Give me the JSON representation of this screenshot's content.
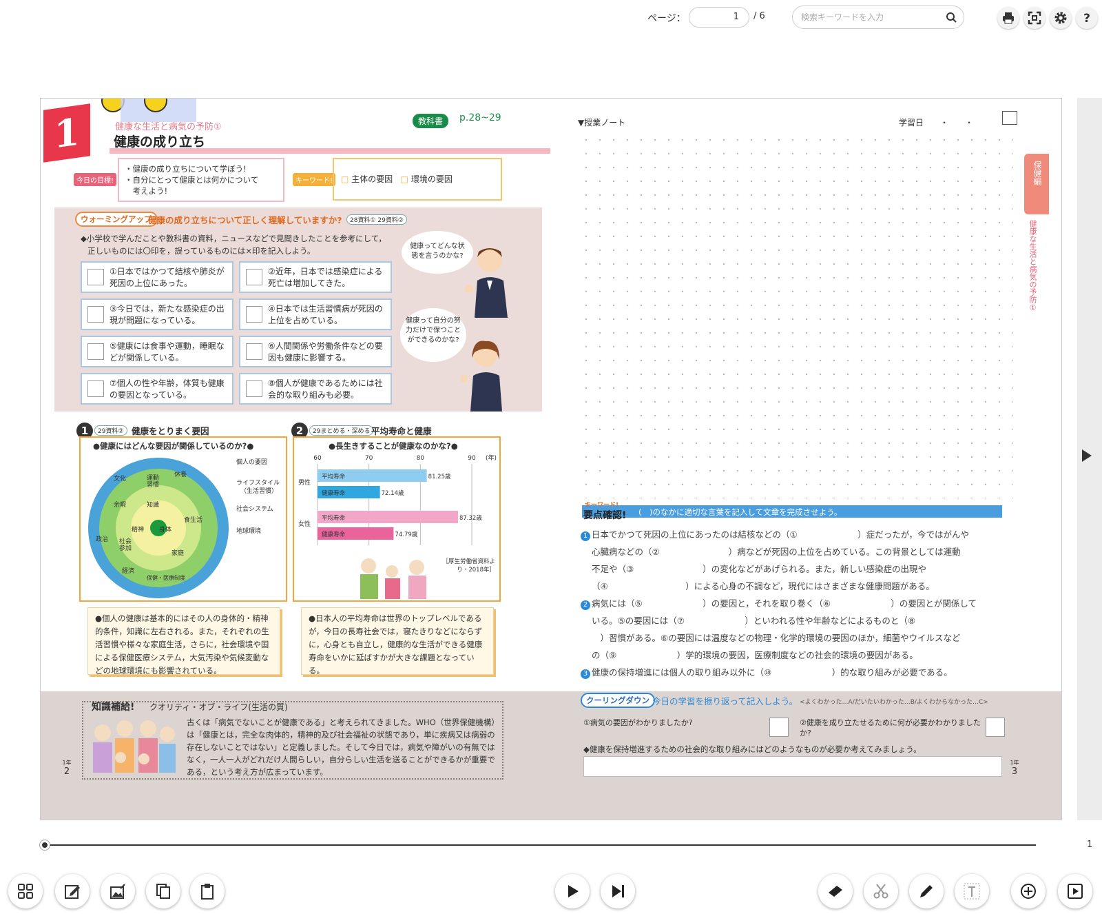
{
  "toolbar": {
    "page_label": "ページ：",
    "page_value": "1",
    "page_total": "/ 6",
    "search_placeholder": "検索キーワードを入力"
  },
  "left_page": {
    "chapter_number": "1",
    "subtitle": "健康な生活と病気の予防①",
    "title": "健康の成り立ち",
    "textbook_badge": "教科書",
    "textbook_pages": "p.28~29",
    "goal_label": "今日の目標!",
    "goals": [
      "・健康の成り立ちについて学ぼう!",
      "・自分にとって健康とは何かについて",
      "　考えよう!"
    ],
    "keyword_label": "キーワード!",
    "keywords": [
      "主体の要因",
      "環境の要因"
    ],
    "warmup": {
      "badge": "ウォーミングアップ",
      "question": "健康の成り立ちについて正しく理解していますか?",
      "ref": "28資料① 29資料②",
      "instruction1": "◆小学校で学んだことや教科書の資料，ニュースなどで見聞きしたことを参考にして，",
      "instruction2": "正しいものには〇印を，誤っているものには×印を記入しよう。",
      "items": [
        "①日本ではかつて結核や肺炎が死因の上位にあった。",
        "②近年，日本では感染症による死亡は増加してきた。",
        "③今日では，新たな感染症の出現が問題になっている。",
        "④日本では生活習慣病が死因の上位を占めている。",
        "⑤健康には食事や運動，睡眠などが関係している。",
        "⑥人間関係や労働条件などの要因も健康に影響する。",
        "⑦個人の性や年齢，体質も健康の要因となっている。",
        "⑧個人が健康であるためには社会的な取り組みも必要。"
      ],
      "bubble1": "健康ってどんな状態を言うのかな?",
      "bubble2": "健康って自分の努力だけで保つことができるのかな?"
    },
    "section1": {
      "number": "1",
      "ref": "29資料②",
      "title": "健康をとりまく要因",
      "question": "●健康にはどんな要因が関係しているのか?●",
      "legend": [
        "個人の要因",
        "ライフスタイル",
        "（生活習慣）",
        "社会システム",
        "地球環境"
      ],
      "center_labels": [
        "知識",
        "精神",
        "身体"
      ],
      "inner_labels": [
        "運動習慣",
        "食生活",
        "休養"
      ],
      "middle_labels": [
        "文化",
        "教育",
        "余暇",
        "社会参加",
        "家庭"
      ],
      "outer_labels": [
        "政治",
        "経済",
        "保健・医療制度"
      ],
      "explanation": "●個人の健康は基本的にはその人の身体的・精神的条件，知識に左右される。また，それぞれの生活習慣や様々な家庭生活，さらに，社会環境や国による保健医療システム，大気汚染や気候変動などの地球環境にも影響されている。"
    },
    "section2": {
      "number": "2",
      "ref": "29まとめる・深める",
      "title": "平均寿命と健康",
      "question": "●長生きすることが健康なのかな?●",
      "explanation": "●日本人の平均寿命は世界のトップレベルであるが，今日の長寿社会では，寝たきりなどにならずに，心身とも自立し，健康的な生活ができる健康寿命をいかに延ばすかが大きな課題となっている。",
      "source": "［厚生労働省資料より・2018年］"
    },
    "knowledge": {
      "title": "知識補給!",
      "subtitle": "クオリティ・オブ・ライフ(生活の質)",
      "text": "古くは「病気でないことが健康である」と考えられてきました。WHO（世界保健機構）は「健康とは，完全な肉体的，精神的及び社会福祉の状態であり，単に疾病又は病弱の存在しないことではない」と定義しました。そして今日では，病気や障がいの有無ではなく，一人一人がどれだけ人間らしい，自分らしい生活を送ることができるかが重要である，という考え方が広まっています。"
    },
    "page_grade": "1年",
    "page_number": "2"
  },
  "chart_data": {
    "type": "bar",
    "x_ticks": [
      "60",
      "70",
      "80",
      "90"
    ],
    "x_unit": "(年)",
    "xlim": [
      60,
      90
    ],
    "groups": [
      {
        "name": "男性",
        "bars": [
          {
            "label": "平均寿命",
            "value": 81.25,
            "text": "81.25歳"
          },
          {
            "label": "健康寿命",
            "value": 72.14,
            "text": "72.14歳"
          }
        ]
      },
      {
        "name": "女性",
        "bars": [
          {
            "label": "平均寿命",
            "value": 87.32,
            "text": "87.32歳"
          },
          {
            "label": "健康寿命",
            "value": 74.79,
            "text": "74.79歳"
          }
        ]
      }
    ],
    "colors": {
      "male_avg": "#8fcdf0",
      "male_health": "#2fa8e0",
      "female_avg": "#f2a7c8",
      "female_health": "#e8649a"
    }
  },
  "right_page": {
    "notes_header": "▼授業ノート",
    "study_date": "学習日　　・　　・",
    "side_tab": "保健編",
    "side_text": "健康な生活と病気の予防①",
    "keyword_check_label": "キーワード!",
    "keyword_check_title": "要点確認!",
    "keyword_check_instruction": "(　)のなかに適切な言葉を記入して文章を完成させよう。",
    "summary": [
      {
        "num": "1",
        "lines": [
          "日本でかつて死因の上位にあったのは結核などの（①　　　　　　　）症だったが，今ではがんや",
          "心臓病などの（②　　　　　　　　）病などが死因の上位を占めている。この背景としては運動",
          "不足や（③　　　　　　　　）の変化などがあげられる。また，新しい感染症の出現や",
          "（④　　　　　　　　　）による心身の不調など，現代にはさまざまな健康問題がある。"
        ]
      },
      {
        "num": "2",
        "lines": [
          "病気には（⑤　　　　　　　）の要因と，それを取り巻く（⑥　　　　　　　）の要因とが関係して",
          "いる。⑤の要因には（⑦　　　　　　　）といわれる性や年齢などによるものと（⑧",
          "　）習慣がある。⑥の要因には温度などの物理・化学的環境の要因のほか，細菌やウイルスなど",
          "の（⑨　　　　　　　）学的環境の要因，医療制度などの社会的環境の要因がある。"
        ]
      },
      {
        "num": "3",
        "lines": [
          "健康の保持増進には個人の取り組み以外に（⑩　　　　　　　）的な取り組みが必要である。"
        ]
      }
    ],
    "cooldown": {
      "badge": "クーリングダウン",
      "instruction": "今日の学習を振り返って記入しよう。",
      "scale": "<よくわかった…A/だいたいわかった…B/よくわからなかった…C>",
      "q1": "①病気の要因がわかりましたか?",
      "q2": "②健康を成り立たせるために何が必要かわかりましたか?",
      "q3": "◆健康を保持増進するための社会的な取り組みにはどのようなものが必要か考えてみましょう。"
    },
    "page_grade": "1年",
    "page_number": "3"
  },
  "timeline": {
    "current": "1"
  },
  "icons": [
    "print-icon",
    "fullscreen-icon",
    "gear-icon",
    "help-icon",
    "search-icon",
    "grid-icon",
    "edit-note-icon",
    "image-edit-icon",
    "copy-icon",
    "clipboard-icon",
    "play-icon",
    "skip-end-icon",
    "eraser-icon",
    "scissors-icon",
    "pen-icon",
    "text-icon",
    "zoom-in-icon",
    "slideshow-icon"
  ]
}
